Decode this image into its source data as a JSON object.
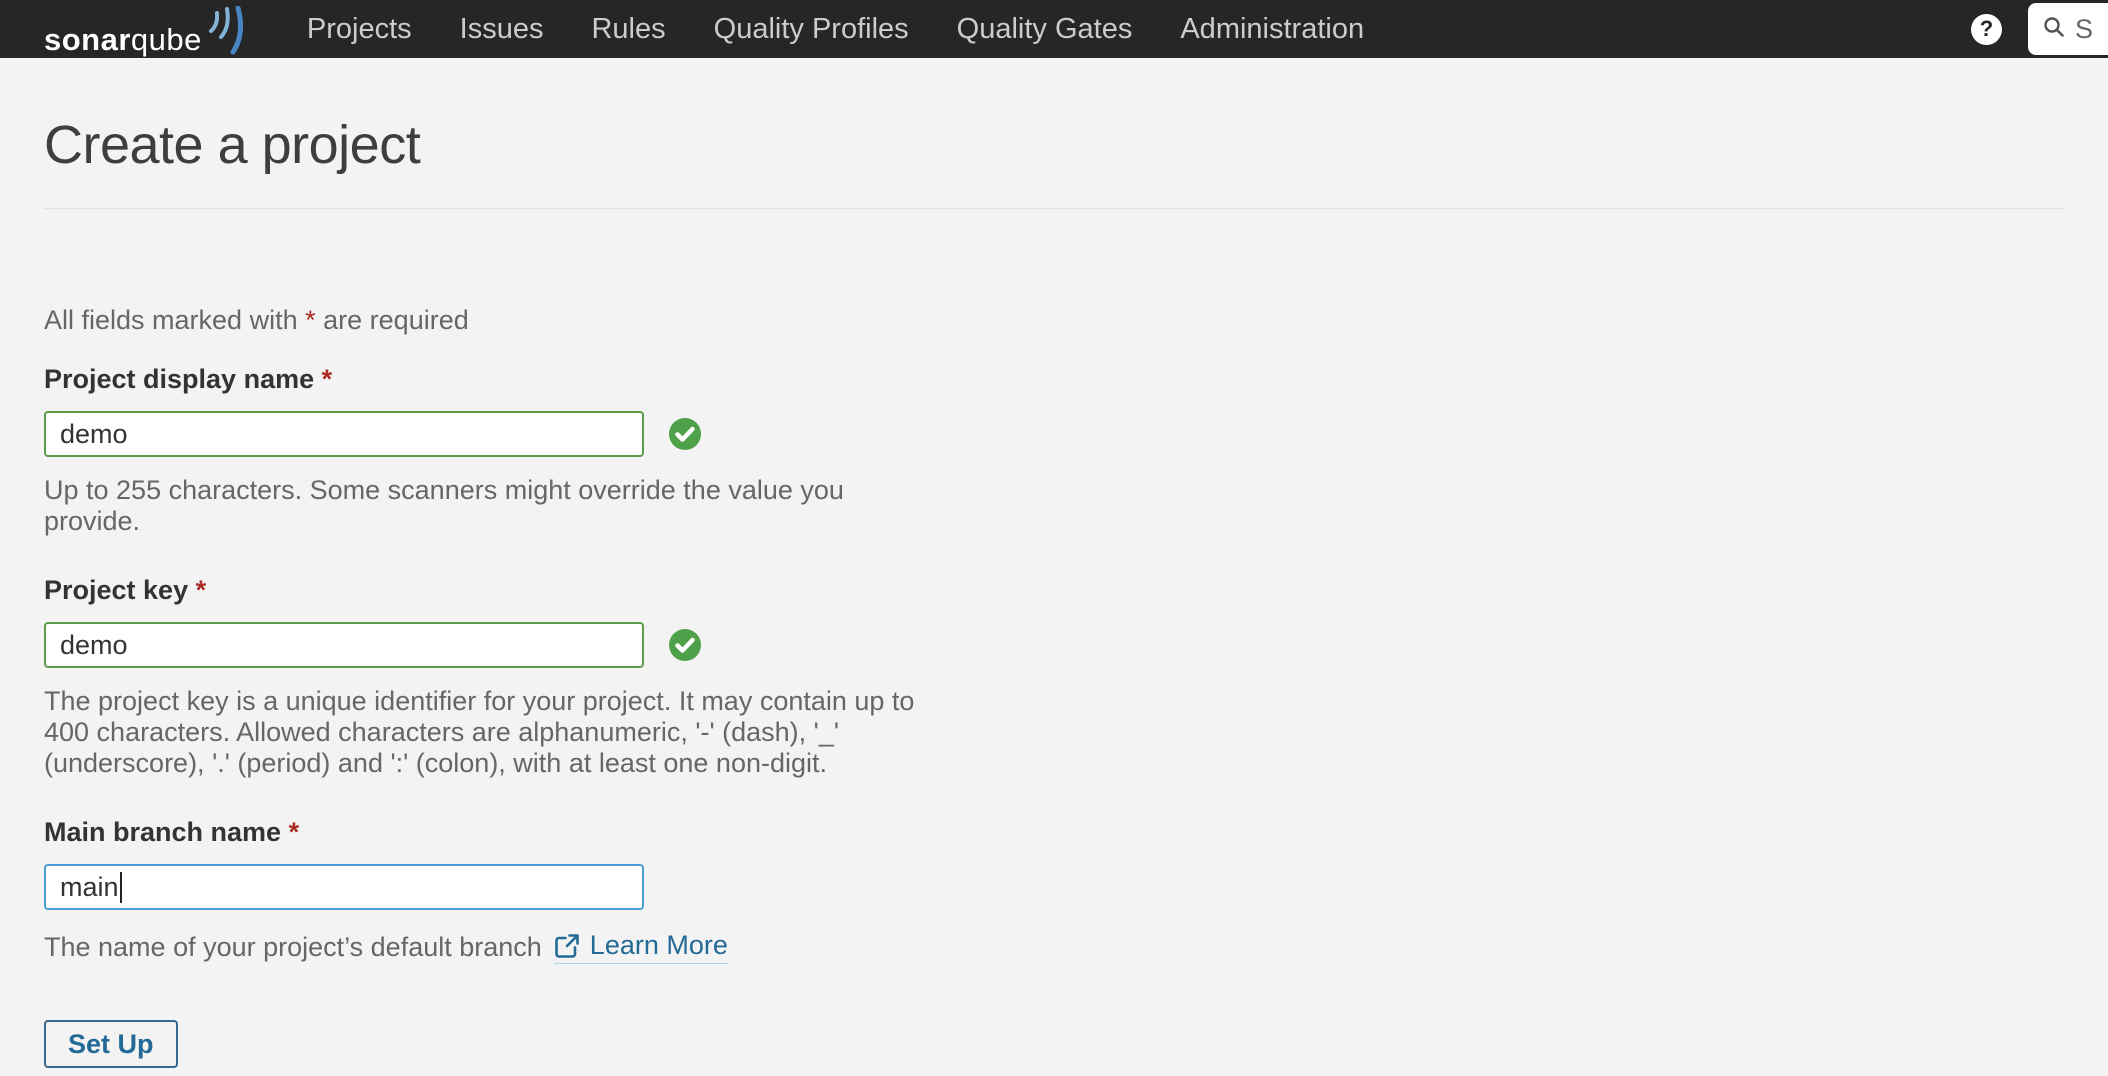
{
  "navbar": {
    "brand_bold": "sonar",
    "brand_light": "qube",
    "items": [
      {
        "label": "Projects"
      },
      {
        "label": "Issues"
      },
      {
        "label": "Rules"
      },
      {
        "label": "Quality Profiles"
      },
      {
        "label": "Quality Gates"
      },
      {
        "label": "Administration"
      }
    ],
    "help_glyph": "?",
    "search_visible_text": "S"
  },
  "page": {
    "title": "Create a project",
    "required_note_prefix": "All fields marked with",
    "required_note_asterisk": "*",
    "required_note_suffix": "are required"
  },
  "form": {
    "fields": [
      {
        "label": "Project display name",
        "required_mark": "*",
        "value": "demo",
        "status": "valid",
        "help_lines": [
          "Up to 255 characters. Some scanners might override the value you",
          "provide."
        ]
      },
      {
        "label": "Project key",
        "required_mark": "*",
        "value": "demo",
        "status": "valid",
        "help_lines": [
          "The project key is a unique identifier for your project. It may contain up to",
          "400 characters. Allowed characters are alphanumeric, '-' (dash), '_'",
          "(underscore), '.' (period) and ':' (colon), with at least one non-digit."
        ]
      },
      {
        "label": "Main branch name",
        "required_mark": "*",
        "value": "main",
        "status": "focused",
        "help_prefix": "The name of your project’s default branch",
        "link_label": "Learn More"
      }
    ],
    "submit_label": "Set Up"
  },
  "colors": {
    "navbar_bg": "#262626",
    "nav_text": "#cccccc",
    "page_bg": "#f3f3f3",
    "title_text": "#3e3e3e",
    "body_text": "#666666",
    "label_text": "#333333",
    "input_text": "#333333",
    "mandatory_red": "#ab2b24",
    "valid_border": "#5d9c49",
    "success_green": "#4fa149",
    "focus_border": "#4b9fd5",
    "link_blue": "#236a97",
    "button_border": "#39688e",
    "logo_wave_light": "#84b3d8",
    "logo_wave_dark": "#4786c3"
  }
}
